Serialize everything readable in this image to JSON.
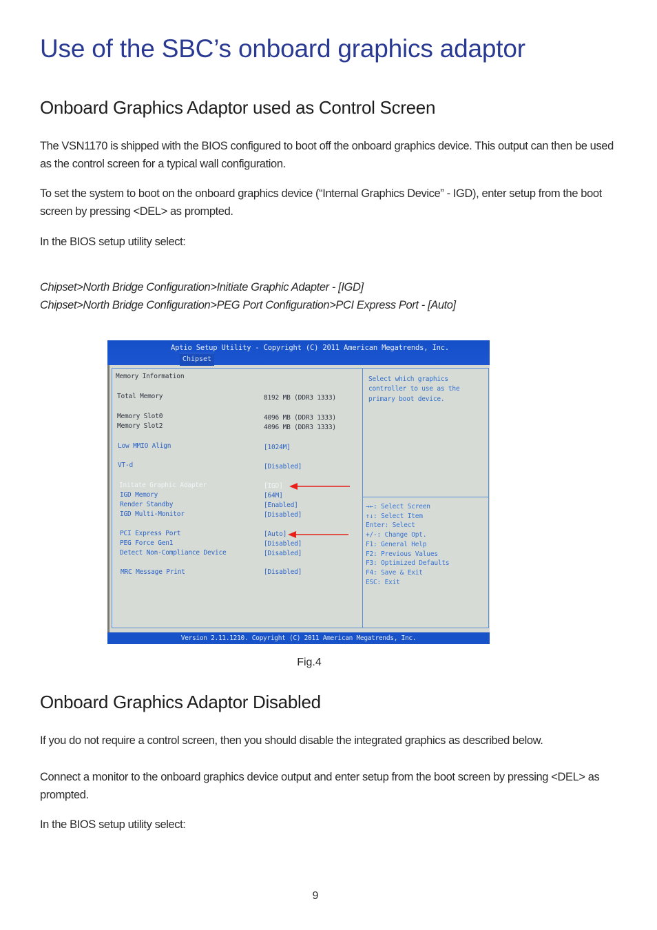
{
  "page": {
    "title": "Use of the SBC’s onboard graphics adaptor",
    "section1": {
      "heading": "Onboard Graphics Adaptor used as Control Screen",
      "paragraphs": [
        "The VSN1170 is shipped with the BIOS configured to boot off the onboard graphics device.  This output can then be used as the control screen for a typical wall configuration.",
        "To set the system to boot on the onboard graphics device (“Internal Graphics Device” - IGD), enter setup from the boot screen by pressing <DEL> as prompted.",
        "In the BIOS setup utility select:"
      ],
      "paths": [
        "Chipset>North Bridge Configuration>Initiate Graphic Adapter - [IGD]",
        "Chipset>North Bridge Configuration>PEG Port Configuration>PCI Express Port - [Auto]"
      ]
    },
    "figure": {
      "caption": "Fig.4",
      "bios": {
        "header": "Aptio Setup Utility - Copyright (C) 2011 American Megatrends, Inc.",
        "tab": "Chipset",
        "footer": "Version 2.11.1210. Copyright (C) 2011 American Megatrends, Inc.",
        "rows": [
          {
            "label": "Memory Information",
            "value": ""
          },
          {
            "label": "Total Memory",
            "value": "8192 MB (DDR3 1333)"
          },
          {
            "label": "Memory Slot0",
            "value": "4096 MB (DDR3 1333)"
          },
          {
            "label": "Memory Slot2",
            "value": "4096 MB (DDR3 1333)"
          },
          {
            "label": "Low MMIO Align",
            "value": "[1024M]"
          },
          {
            "label": "VT-d",
            "value": "[Disabled]"
          },
          {
            "label": "Initate Graphic Adapter",
            "value": "[IGD]"
          },
          {
            "label": "IGD Memory",
            "value": "[64M]"
          },
          {
            "label": "Render Standby",
            "value": "[Enabled]"
          },
          {
            "label": "IGD Multi-Monitor",
            "value": "[Disabled]"
          },
          {
            "label": "PCI Express Port",
            "value": "[Auto]"
          },
          {
            "label": "PEG Force Gen1",
            "value": "[Disabled]"
          },
          {
            "label": "Detect Non-Compliance Device",
            "value": "[Disabled]"
          },
          {
            "label": "MRC Message Print",
            "value": "[Disabled]"
          }
        ],
        "help_text": [
          "Select which graphics",
          "controller to use as the",
          "primary boot device."
        ],
        "key_help": [
          "→←: Select Screen",
          "↑↓: Select Item",
          "Enter: Select",
          "+/-: Change Opt.",
          "F1: General Help",
          "F2: Previous Values",
          "F3: Optimized Defaults",
          "F4: Save & Exit",
          "ESC: Exit"
        ],
        "colors": {
          "header_bg": "#1650c8",
          "panel_bg": "#d7dbd5",
          "setting_text": "#2a62c6",
          "selected_text": "#f1f4f6",
          "annotation_arrow": "#e8201c"
        }
      }
    },
    "section2": {
      "heading": "Onboard Graphics Adaptor Disabled",
      "paragraphs": [
        "If you do not require a control screen, then you should disable the integrated graphics as described below.",
        "Connect a monitor to the onboard graphics device output and enter setup from the boot screen by pressing <DEL> as prompted.",
        "In the BIOS setup utility select:"
      ]
    },
    "page_number": "9"
  }
}
